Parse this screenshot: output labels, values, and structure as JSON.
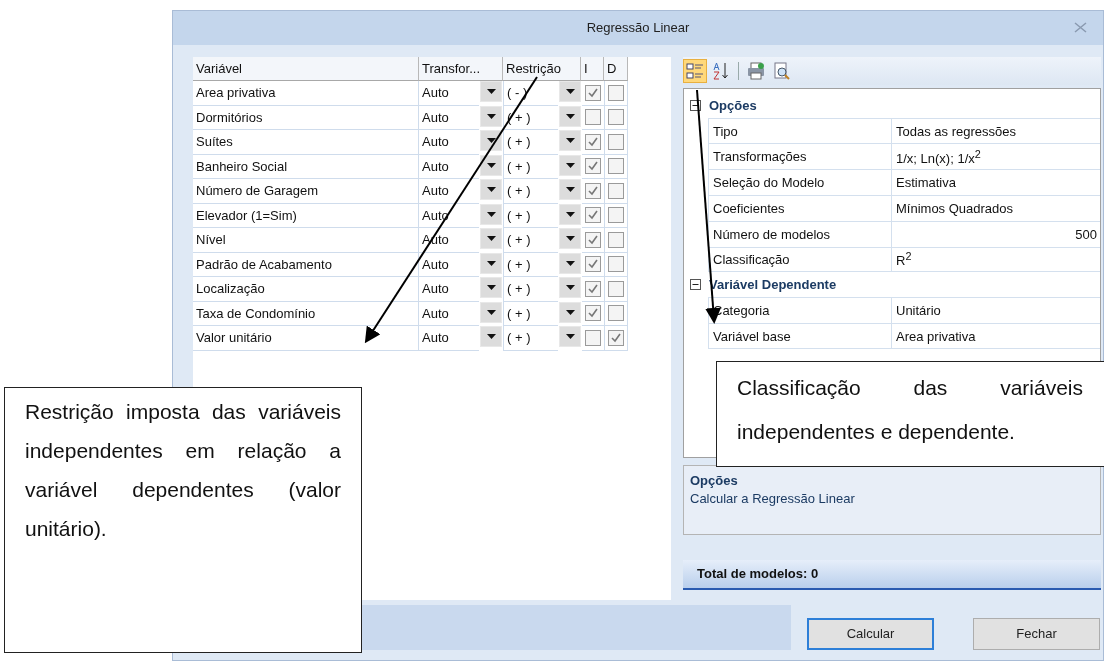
{
  "window": {
    "title": "Regressão Linear"
  },
  "variables_table": {
    "columns": [
      "Variável",
      "Transfor...",
      "Restrição",
      "I",
      "D"
    ],
    "rows": [
      {
        "name": "Area privativa",
        "transform": "Auto",
        "restriction": "( - )",
        "independent": true,
        "dependent": false
      },
      {
        "name": "Dormitórios",
        "transform": "Auto",
        "restriction": "( + )",
        "independent": false,
        "dependent": false
      },
      {
        "name": "Suítes",
        "transform": "Auto",
        "restriction": "( + )",
        "independent": true,
        "dependent": false
      },
      {
        "name": "Banheiro Social",
        "transform": "Auto",
        "restriction": "( + )",
        "independent": true,
        "dependent": false
      },
      {
        "name": "Número de Garagem",
        "transform": "Auto",
        "restriction": "( + )",
        "independent": true,
        "dependent": false
      },
      {
        "name": "Elevador (1=Sim)",
        "transform": "Auto",
        "restriction": "( + )",
        "independent": true,
        "dependent": false
      },
      {
        "name": "Nível",
        "transform": "Auto",
        "restriction": "( + )",
        "independent": true,
        "dependent": false
      },
      {
        "name": "Padrão de Acabamento",
        "transform": "Auto",
        "restriction": "( + )",
        "independent": true,
        "dependent": false
      },
      {
        "name": "Localização",
        "transform": "Auto",
        "restriction": "( + )",
        "independent": true,
        "dependent": false
      },
      {
        "name": "Taxa de Condomínio",
        "transform": "Auto",
        "restriction": "( + )",
        "independent": true,
        "dependent": false
      },
      {
        "name": "Valor unitário",
        "transform": "Auto",
        "restriction": "( + )",
        "independent": false,
        "dependent": true
      }
    ]
  },
  "toolbar": [
    {
      "kind": "categorized",
      "selected": true
    },
    {
      "kind": "alphabetical",
      "selected": false
    },
    {
      "kind": "separator"
    },
    {
      "kind": "print",
      "selected": false
    },
    {
      "kind": "preview",
      "selected": false
    }
  ],
  "property_grid": [
    {
      "title": "Opções",
      "expanded": true,
      "properties": [
        {
          "name": "Tipo",
          "value": "Todas as regressões",
          "kind": "text"
        },
        {
          "name": "Transformações",
          "value": "1/x; Ln(x); 1/x$^{2}$",
          "kind": "text"
        },
        {
          "name": "Seleção do Modelo",
          "value": "Estimativa",
          "kind": "text"
        },
        {
          "name": "Coeficientes",
          "value": "Mínimos Quadrados",
          "kind": "text"
        },
        {
          "name": "Número de modelos",
          "value": "500",
          "kind": "number"
        },
        {
          "name": "Classificação",
          "value": "R$^{2}$",
          "kind": "text"
        }
      ]
    },
    {
      "title": "Variável Dependente",
      "expanded": true,
      "properties": [
        {
          "name": "Categoria",
          "value": "Unitário",
          "kind": "text"
        },
        {
          "name": "Variável base",
          "value": "Area privativa",
          "kind": "text"
        }
      ]
    }
  ],
  "description": {
    "title": "Opções",
    "text": "Calcular a Regressão Linear"
  },
  "status": "Total de modelos: 0",
  "buttons": [
    {
      "label": "Calcular",
      "default": true
    },
    {
      "label": "Fechar",
      "default": false
    }
  ],
  "callouts": [
    "Restrição imposta das variáveis independentes em relação a variável dependentes (valor unitário).",
    "Classificação das variáveis independentes e dependente."
  ]
}
